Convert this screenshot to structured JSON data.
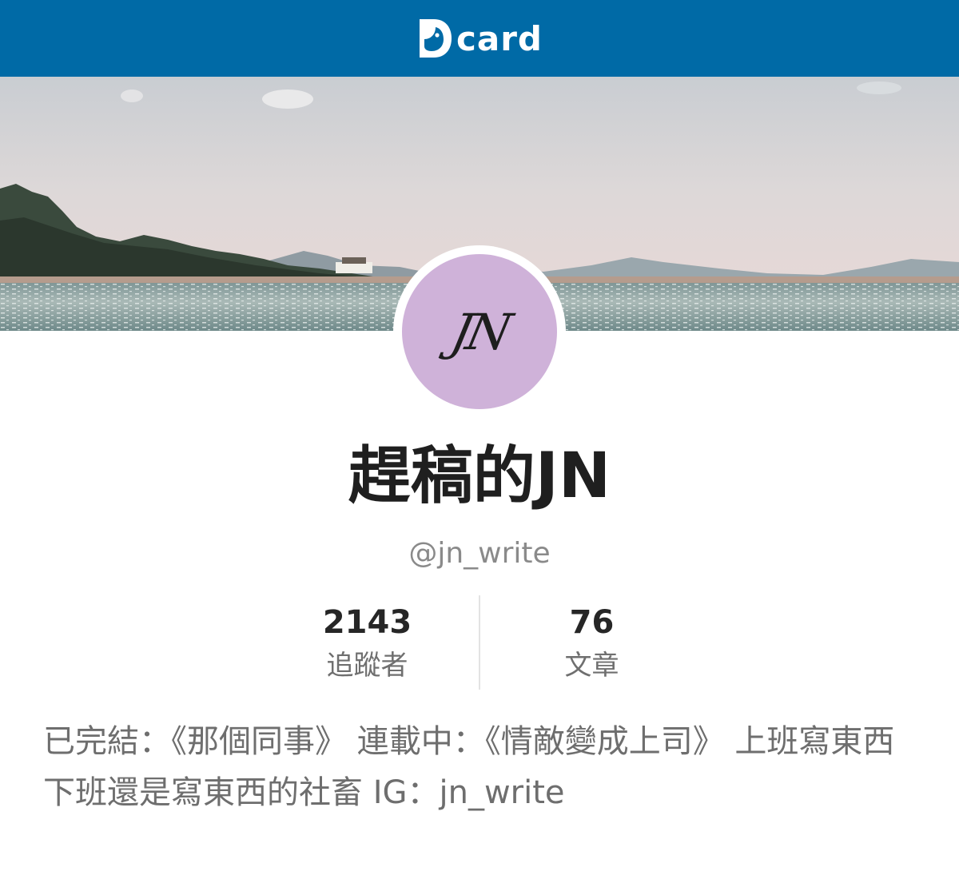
{
  "colors": {
    "header_background": "#006aa6",
    "avatar_background": "#cfb2d9",
    "name_text": "#1f1f1f",
    "secondary_text": "#8a8a8a"
  },
  "header": {
    "logo_text": "card",
    "logo_icon": "dcard-logo-icon"
  },
  "profile": {
    "avatar_initials": "JN",
    "display_name": "趕稿的JN",
    "handle": "@jn_write",
    "stats": [
      {
        "value": "2143",
        "label": "追蹤者"
      },
      {
        "value": "76",
        "label": "文章"
      }
    ],
    "bio": "已完結：《那個同事》 連載中：《情敵變成上司》 上班寫東西下班還是寫東西的社畜 IG：jn_write"
  }
}
